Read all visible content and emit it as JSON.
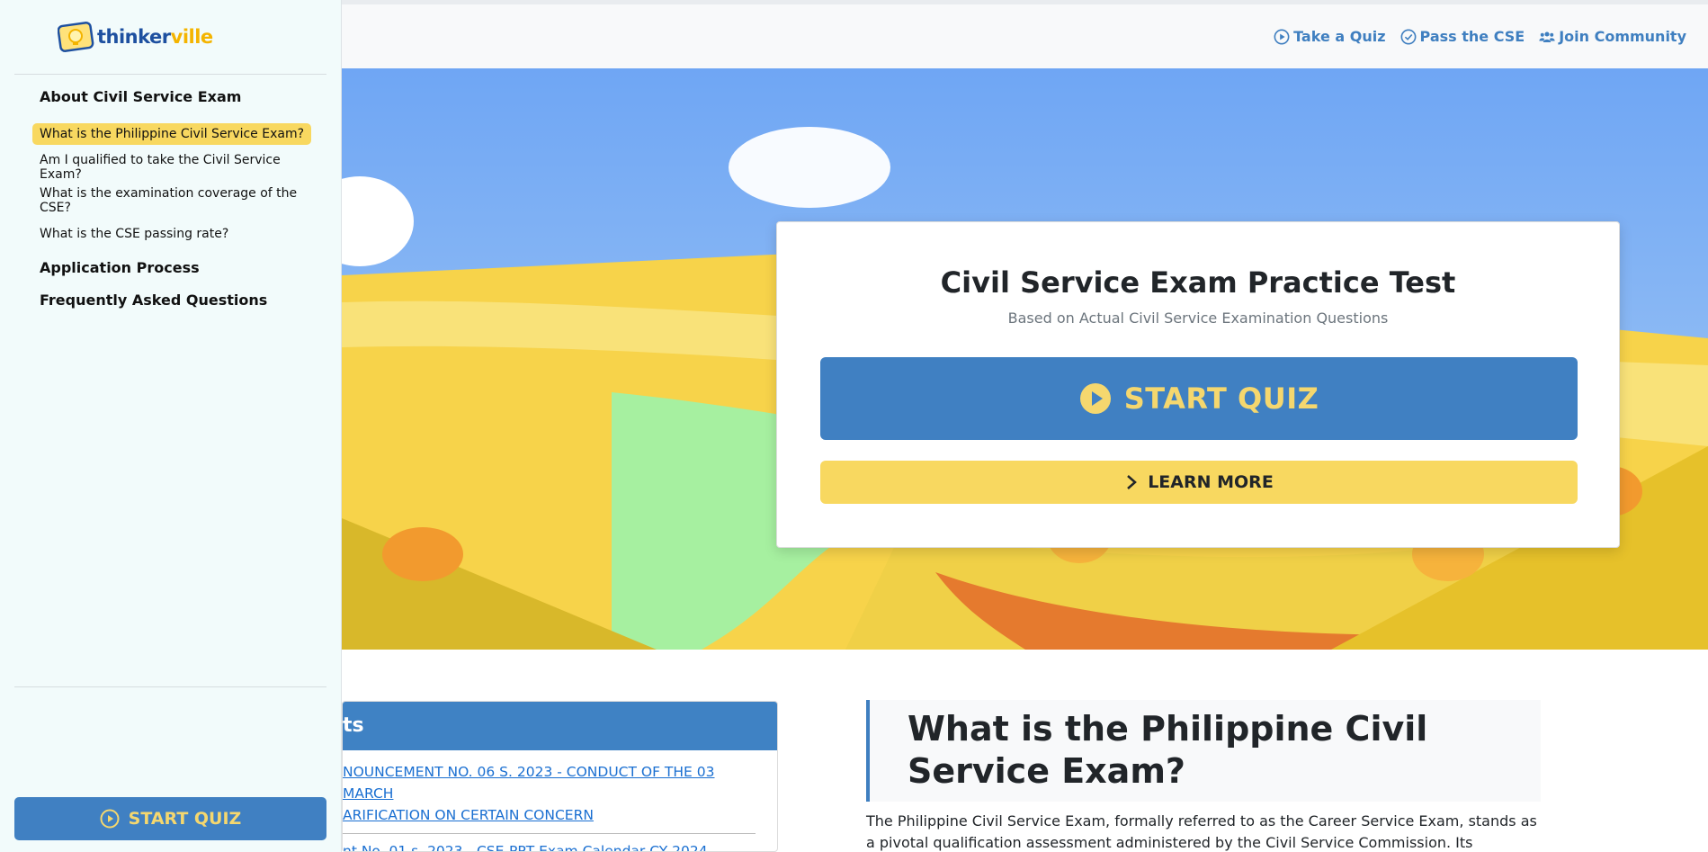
{
  "brand": {
    "logo_text_1": "thinker",
    "logo_text_2": "ville",
    "colors": {
      "primary": "#4080c2",
      "accent": "#f8d860",
      "link": "#1a6fd1"
    }
  },
  "topnav": {
    "items": [
      {
        "label": "Take a Quiz",
        "icon": "play-circle-icon"
      },
      {
        "label": "Pass the CSE",
        "icon": "check-circle-icon"
      },
      {
        "label": "Join Community",
        "icon": "users-icon"
      }
    ]
  },
  "sidebar": {
    "sections": [
      {
        "title": "About Civil Service Exam",
        "items": [
          {
            "label": "What is the Philippine Civil Service Exam?",
            "active": true
          },
          {
            "label": "Am I qualified to take the Civil Service Exam?"
          },
          {
            "label": "What is the examination coverage of the CSE?"
          },
          {
            "label": "What is the CSE passing rate?"
          }
        ]
      },
      {
        "title": "Application Process"
      },
      {
        "title": "Frequently Asked Questions"
      }
    ],
    "start_button": "START QUIZ"
  },
  "hero": {
    "title": "Civil Service Exam Practice Test",
    "subtitle": "Based on Actual Civil Service Examination Questions",
    "start_button": "START QUIZ",
    "learn_button": "LEARN MORE"
  },
  "announcements": {
    "header": "ts",
    "link1_line1": "NOUNCEMENT NO. 06 S. 2023 - CONDUCT OF THE 03 MARCH",
    "link1_line2": "ARIFICATION ON CERTAIN CONCERN",
    "link2": "nt No. 01 s. 2023 - CSE-PPT Exam Calendar CY 2024"
  },
  "article": {
    "title": "What is the Philippine Civil Service Exam?",
    "body": "The Philippine Civil Service Exam, formally referred to as the Career Service Exam, stands as a pivotal qualification assessment administered by the Civil Service Commission. Its successful completion"
  }
}
